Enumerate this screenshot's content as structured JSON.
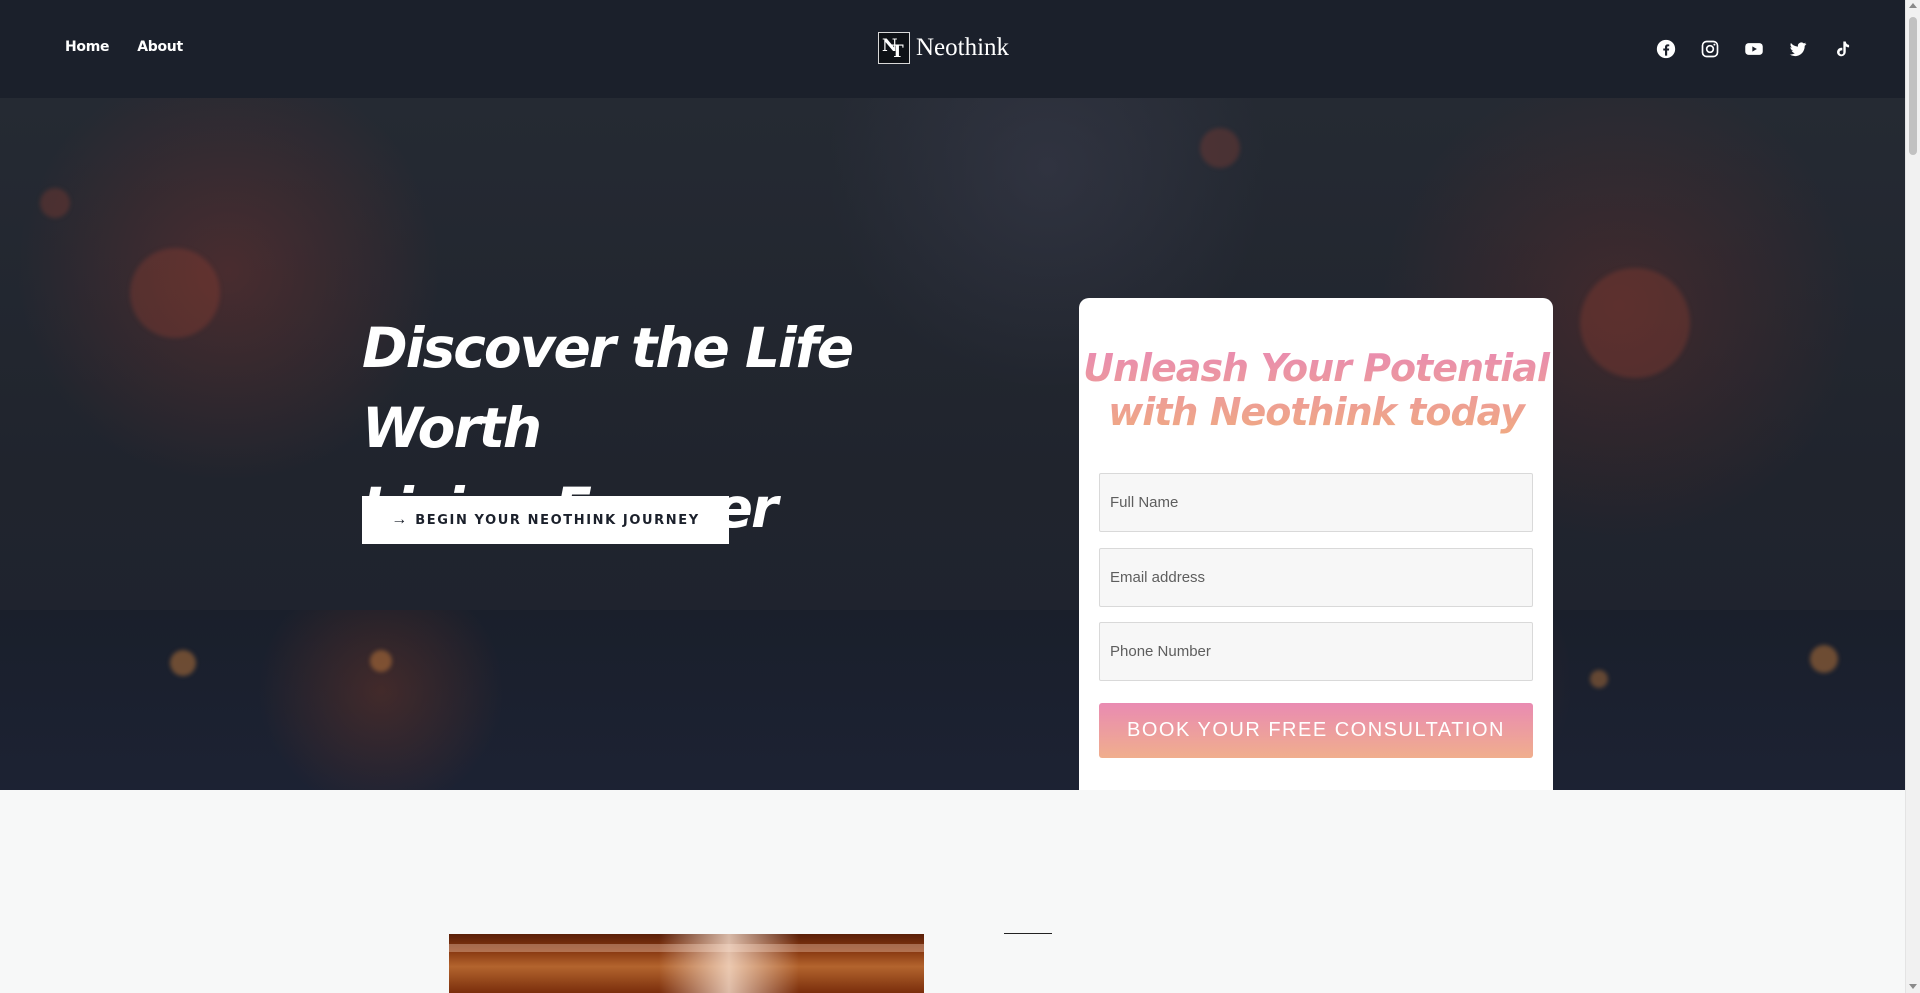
{
  "header": {
    "nav": [
      {
        "label": "Home"
      },
      {
        "label": "About"
      }
    ],
    "brand": {
      "name": "Neothink",
      "mark_letters": [
        "N",
        "T"
      ]
    },
    "socials": [
      {
        "icon": "facebook-icon"
      },
      {
        "icon": "instagram-icon"
      },
      {
        "icon": "youtube-icon"
      },
      {
        "icon": "twitter-icon"
      },
      {
        "icon": "tiktok-icon"
      }
    ]
  },
  "hero": {
    "title_line1": "Discover the Life Worth",
    "title_line2": "Living Forever",
    "cta_arrow": "→",
    "cta_label": "BEGIN YOUR NEOTHINK JOURNEY"
  },
  "form": {
    "title_line1": "Unleash Your Potential",
    "title_line2": "with Neothink today",
    "fields": [
      {
        "placeholder": "Full Name",
        "value": ""
      },
      {
        "placeholder": "Email address",
        "value": ""
      },
      {
        "placeholder": "Phone Number",
        "value": ""
      }
    ],
    "submit_label": "BOOK YOUR FREE CONSULTATION"
  },
  "colors": {
    "header_bg": "#1b202b",
    "gradient_pink": "#e98bb2",
    "gradient_peach": "#f0a983",
    "page_bg": "#f7f8f8"
  }
}
